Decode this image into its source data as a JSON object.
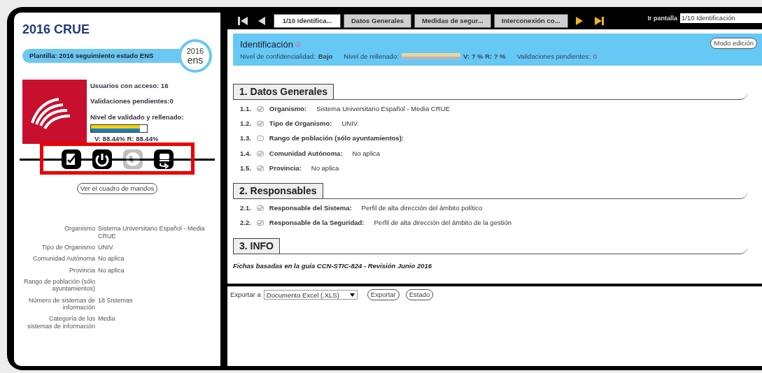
{
  "sidebar": {
    "title": "2016 CRUE",
    "template": "Plantilla: 2016 seguimiento estado ENS",
    "logo": {
      "line1": "2016",
      "line2": "ens"
    },
    "stats": [
      "Usuarios con acceso: 16",
      "Validaciones pendientes:0"
    ],
    "progress": {
      "label": "Nivel de validado y rellenado:",
      "level": 0.88,
      "reading": "V: 88.44% R: 88.44%"
    },
    "tools": [
      {
        "kind": "edit",
        "disabled": false
      },
      {
        "kind": "power",
        "disabled": false
      },
      {
        "kind": "globe",
        "disabled": true
      },
      {
        "kind": "export",
        "disabled": false
      }
    ],
    "dashboard_button": "Ver el cuadro de mandos",
    "details": [
      {
        "label": "Organismo",
        "value": "Sistema Universitario Español - Media CRUE"
      },
      {
        "label": "Tipo de Organismo",
        "value": "UNIV."
      },
      {
        "label": "Comunidad Autónoma",
        "value": "No aplica"
      },
      {
        "label": "Provincia",
        "value": "No aplica"
      },
      {
        "label": "Rango de población (sólo ayuntamientos)"
      },
      {
        "label": "Número de sistemas de información",
        "value": "18 Sistemas"
      },
      {
        "label": "Categoría de los sistemas de información",
        "value": "Media"
      }
    ]
  },
  "toolbar": {
    "nav": [
      {
        "kind": "first",
        "disabled": true
      },
      {
        "kind": "prev",
        "disabled": true
      }
    ],
    "tabs": [
      {
        "label": "1/10 Identifica...",
        "selected": true
      },
      {
        "label": "Datos Generales",
        "selected": false
      },
      {
        "label": "Medidas de segur...",
        "selected": false
      },
      {
        "label": "Interconexión co...",
        "selected": false
      }
    ],
    "nav_end": [
      {
        "kind": "next",
        "disabled": false
      },
      {
        "kind": "last",
        "disabled": false
      }
    ],
    "goto_label": "Ir pantalla",
    "goto_value": "1/10 Identificación"
  },
  "header": {
    "title": "Identificación",
    "confidentiality_label": "Nivel de confidencialidad:",
    "confidentiality": "Bajo",
    "fill_label": "Nivel de rellenado:",
    "fill": {
      "level": 1
    },
    "fill_reading": "V: ? % R: ? %",
    "pending_label": "Validaciones pendientes:",
    "pending": "0",
    "edit_button": "Modo edición"
  },
  "sections": [
    {
      "title": "1. Datos Generales",
      "items": [
        {
          "number": "1.1.",
          "checked": true,
          "label": "Organismo:",
          "value": "Sistema Universitario Español - Media CRUE"
        },
        {
          "number": "1.2.",
          "checked": true,
          "label": "Tipo de Organismo:",
          "value": "UNIV."
        },
        {
          "number": "1.3.",
          "checked": false,
          "label": "Rango de población (sólo ayuntamientos):"
        },
        {
          "number": "1.4.",
          "checked": true,
          "label": "Comunidad Autónoma:",
          "value": "No aplica"
        },
        {
          "number": "1.5.",
          "checked": true,
          "label": "Provincia:",
          "value": "No aplica"
        }
      ]
    },
    {
      "title": "2. Responsables",
      "items": [
        {
          "number": "2.1.",
          "checked": true,
          "label": "Responsable del Sistema:",
          "value": "Perfil de alta dirección del ámbito político"
        },
        {
          "number": "2.2.",
          "checked": true,
          "label": "Responsable de la Seguridad:",
          "value": "Perfil de alta dirección del ámbito de la gestión"
        }
      ]
    },
    {
      "title": "3. INFO",
      "note": "Fichas basadas en la guía CCN-STIC-824 - Revisión Junio 2016"
    }
  ],
  "export": {
    "label": "Exportar a",
    "format": "Documento Excel (.XLS)",
    "buttons": [
      "Exportar",
      "Estado"
    ]
  }
}
